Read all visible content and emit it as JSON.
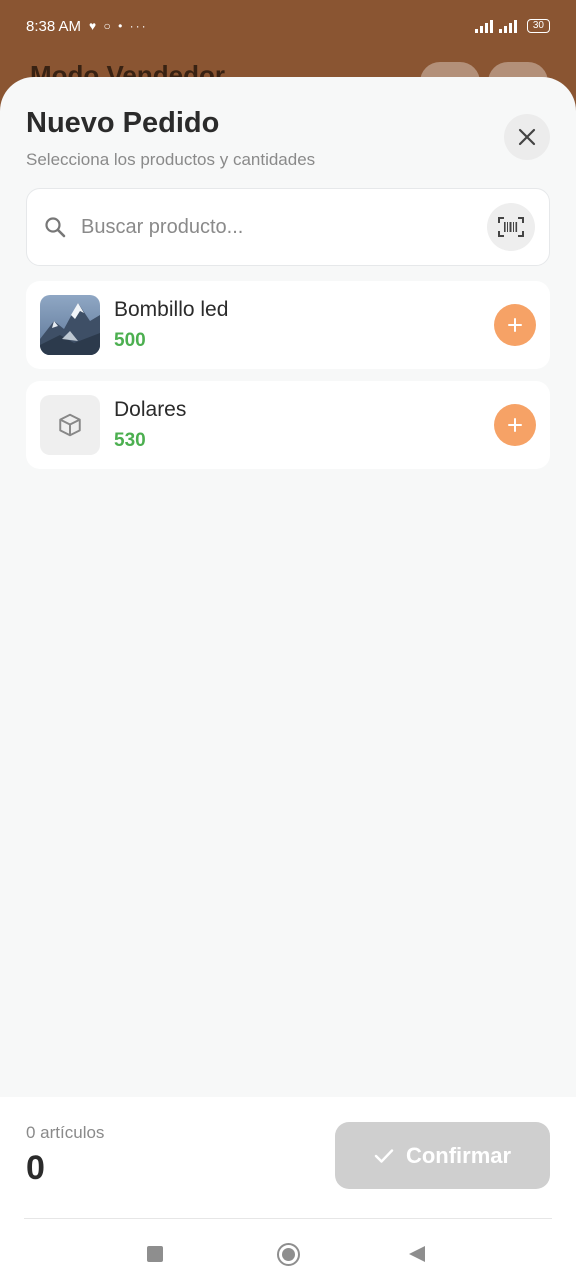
{
  "status_bar": {
    "time": "8:38 AM",
    "extra": "♥ ○ • ···",
    "battery": "30"
  },
  "backdrop": {
    "title": "Modo Vendedor"
  },
  "sheet": {
    "title": "Nuevo Pedido",
    "subtitle": "Selecciona los productos y cantidades",
    "close_icon": "close-icon"
  },
  "search": {
    "placeholder": "Buscar producto...",
    "value": "",
    "scan_icon": "barcode-scan-icon"
  },
  "products": [
    {
      "name": "Bombillo led",
      "price": "500",
      "thumbnail": "mountain-photo"
    },
    {
      "name": "Dolares",
      "price": "530",
      "thumbnail": "box-icon"
    }
  ],
  "footer": {
    "count_label": "0 artículos",
    "total": "0",
    "confirm_label": "Confirmar"
  },
  "colors": {
    "accent": "#f6a266",
    "price": "#4caf50",
    "backdrop": "#8a5532",
    "confirm_disabled": "#cfcfcf"
  }
}
